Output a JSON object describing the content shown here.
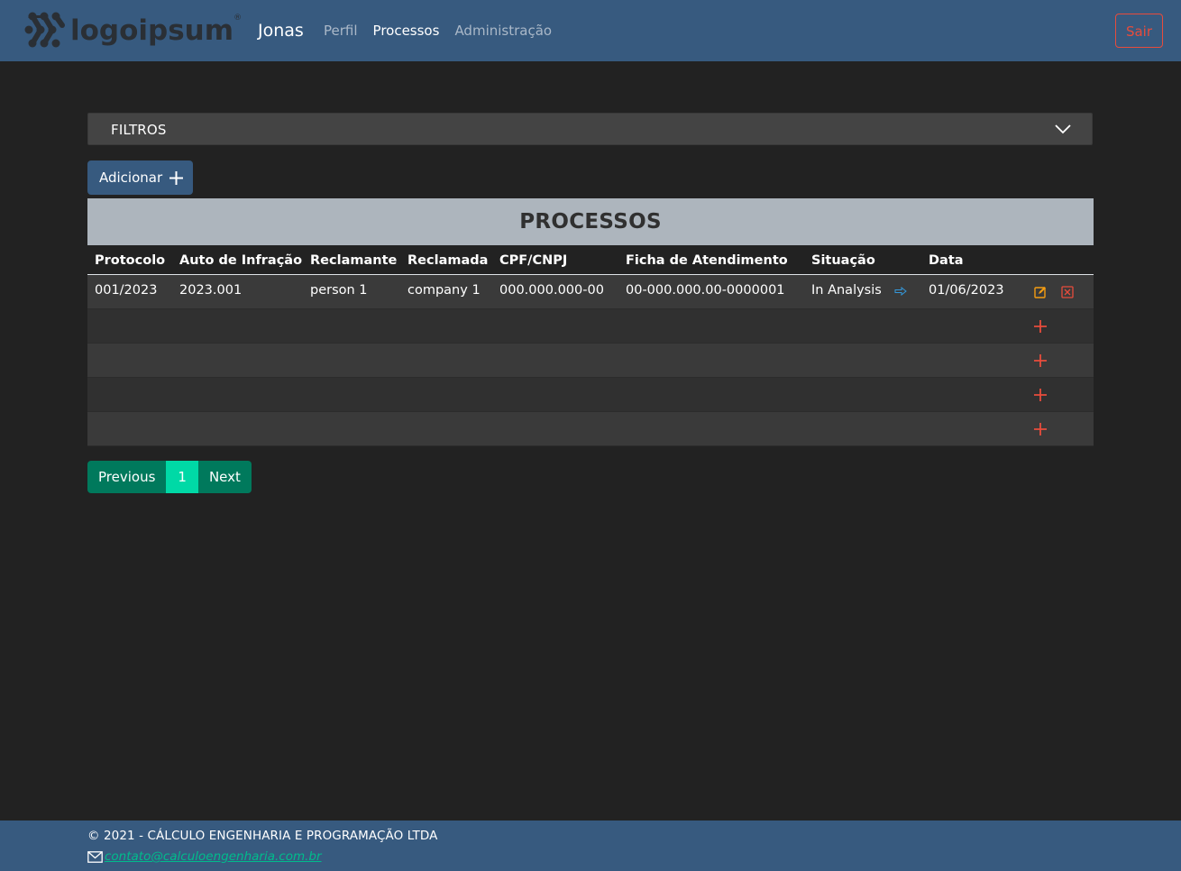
{
  "navbar": {
    "brand": "logoipsum",
    "brand_mark": "®",
    "user": "Jonas",
    "links": [
      {
        "label": "Perfil",
        "active": false
      },
      {
        "label": "Processos",
        "active": true
      },
      {
        "label": "Administração",
        "active": false
      }
    ],
    "logout_label": "Sair"
  },
  "filters": {
    "label": "FILTROS"
  },
  "add_button": {
    "label": "Adicionar"
  },
  "table": {
    "title": "PROCESSOS",
    "headers": [
      "Protocolo",
      "Auto de Infração",
      "Reclamante",
      "Reclamada",
      "CPF/CNPJ",
      "Ficha de Atendimento",
      "Situação",
      "Data"
    ],
    "rows": [
      {
        "protocolo": "001/2023",
        "auto": "2023.001",
        "reclamante": "person 1",
        "reclamada": "company 1",
        "cpf": "000.000.000-00",
        "ficha": "00-000.000.00-0000001",
        "situacao": "In Analysis",
        "data": "01/06/2023"
      }
    ],
    "empty_rows": 4
  },
  "pagination": {
    "previous": "Previous",
    "current": "1",
    "next": "Next"
  },
  "footer": {
    "copyright": "© 2021 - CÁLCULO ENGENHARIA E PROGRAMAÇÃO LTDA",
    "email": "contato@calculoengenharia.com.br"
  },
  "colors": {
    "navbar": "#375a7f",
    "background": "#222222",
    "danger": "#e74c3c",
    "success": "#00bc8c",
    "warning": "#f39c12",
    "info": "#3498db"
  }
}
